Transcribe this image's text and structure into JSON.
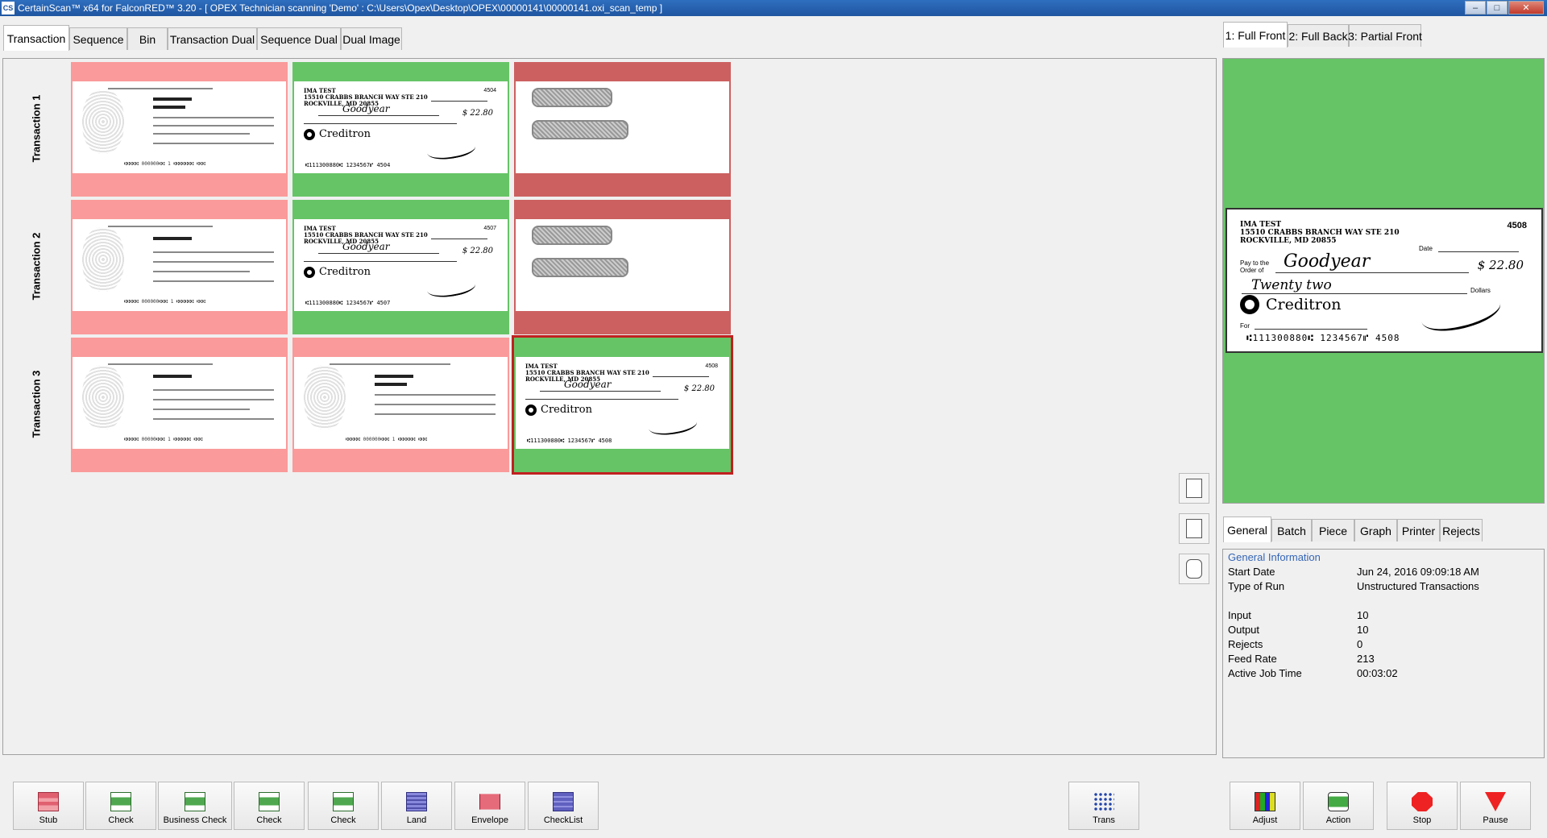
{
  "window": {
    "title": "CertainScan™ x64 for FalconRED™ 3.20 - [ OPEX Technician scanning 'Demo' : C:\\Users\\Opex\\Desktop\\OPEX\\00000141\\00000141.oxi_scan_temp ]",
    "app_icon": "CS"
  },
  "left_tabs": [
    "Transaction",
    "Sequence",
    "Bin",
    "Transaction Dual",
    "Sequence Dual",
    "Dual Image"
  ],
  "right_tabs": [
    "1: Full Front",
    "2: Full Back",
    "3: Partial Front"
  ],
  "info_tabs": [
    "General",
    "Batch",
    "Piece",
    "Graph",
    "Printer",
    "Rejects"
  ],
  "transactions": [
    {
      "label": "Transaction 1"
    },
    {
      "label": "Transaction 2"
    },
    {
      "label": "Transaction 3"
    }
  ],
  "checks": {
    "payer_line1": "IMA TEST",
    "payer_line2": "15510 CRABBS BRANCH WAY STE 210",
    "payer_line3": "ROCKVILLE, MD 20855",
    "t1_num": "4504",
    "t2_num": "4507",
    "t3_num": "4508",
    "payee": "Goodyear",
    "amount": "$ 22.80",
    "brand": "Creditron",
    "micr_t1": "⑆111300880⑆  1234567⑈  4504",
    "micr_t2": "⑆111300880⑆  1234567⑈  4507",
    "micr_t3": "⑆111300880⑆  1234567⑈  4508"
  },
  "preview": {
    "payer_line1": "IMA TEST",
    "payer_line2": "15510 CRABBS BRANCH WAY STE 210",
    "payer_line3": "ROCKVILLE, MD 20855",
    "number": "4508",
    "date_label": "Date",
    "pay_label": "Pay to the Order of",
    "payee": "Goodyear",
    "amount": "$ 22.80",
    "words": "Twenty two",
    "dollars_label": "Dollars",
    "brand": "Creditron",
    "for_label": "For",
    "micr": "⑆111300880⑆  1234567⑈  4508"
  },
  "general_info": {
    "heading": "General Information",
    "start_date_label": "Start Date",
    "start_date": "Jun 24, 2016 09:09:18 AM",
    "type_label": "Type of Run",
    "type": "Unstructured Transactions",
    "input_label": "Input",
    "input": "10",
    "output_label": "Output",
    "output": "10",
    "rejects_label": "Rejects",
    "rejects": "0",
    "feed_rate_label": "Feed Rate",
    "feed_rate": "213",
    "job_time_label": "Active Job Time",
    "job_time": "00:03:02"
  },
  "toolbar": {
    "stub": "Stub",
    "check1": "Check",
    "business_check": "Business Check",
    "check2": "Check",
    "check3": "Check",
    "land": "Land",
    "envelope": "Envelope",
    "checklist": "CheckList",
    "trans": "Trans",
    "adjust": "Adjust",
    "action": "Action",
    "stop": "Stop",
    "pause": "Pause"
  },
  "colors": {
    "accepted": "#66c466",
    "stub": "#fa9a9a",
    "envelope": "#cc6060",
    "selected_border": "#c02020",
    "info_heading": "#3565b5"
  }
}
